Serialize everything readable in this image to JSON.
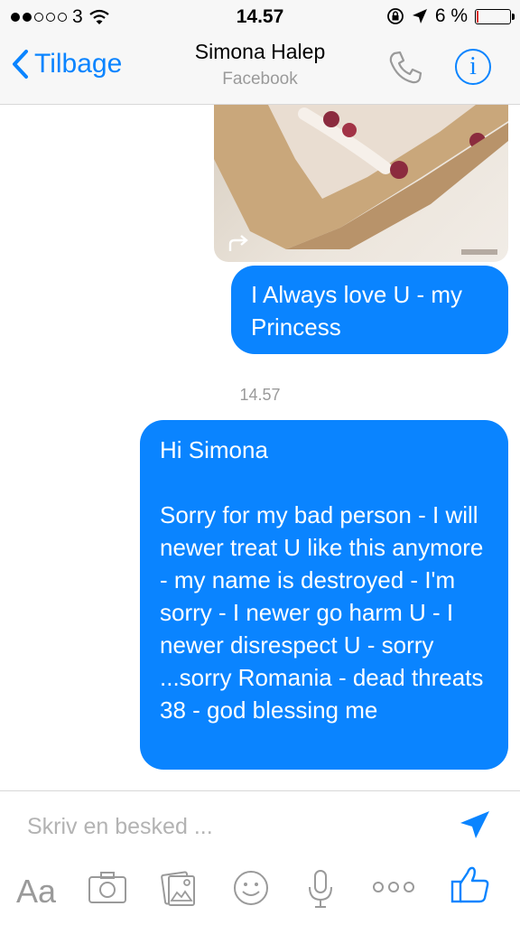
{
  "status_bar": {
    "carrier": "3",
    "time": "14.57",
    "battery_percent_label": "6 %",
    "battery_level": 0.06,
    "signal_bars": 2
  },
  "nav": {
    "back_label": "Tilbage",
    "contact_name": "Simona  Halep",
    "subtitle": "Facebook"
  },
  "messages": [
    {
      "text": "I Always love U - my Princess"
    },
    {
      "text": "Hi Simona\n\nSorry for my bad person - I will newer treat U like this anymore - my name is destroyed - I'm sorry - I newer go harm U - I newer disrespect U - sorry ...sorry Romania - dead threats 38 - god blessing me"
    }
  ],
  "timestamp": "14.57",
  "composer": {
    "placeholder": "Skriv en besked ...",
    "toolbar_text_label": "Aa"
  },
  "colors": {
    "accent": "#0a84ff",
    "bubble": "#0a84ff",
    "battery_low": "#e0302a"
  },
  "icons": [
    "wifi-icon",
    "lock-rotation-icon",
    "location-arrow-icon",
    "battery-icon",
    "chevron-left-icon",
    "phone-icon",
    "info-icon",
    "share-icon",
    "send-icon",
    "camera-icon",
    "gallery-icon",
    "smiley-icon",
    "microphone-icon",
    "more-icon",
    "thumbs-up-icon"
  ]
}
